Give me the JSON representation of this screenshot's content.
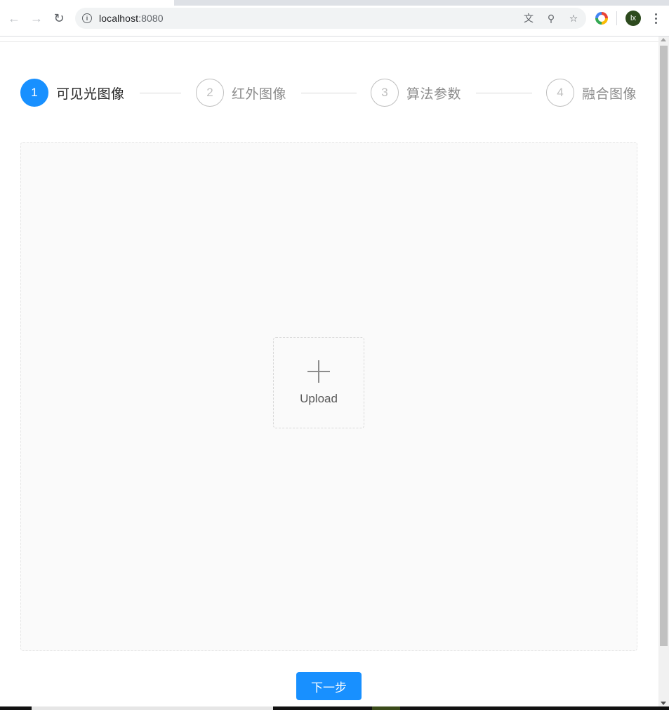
{
  "browser": {
    "url_host": "localhost",
    "url_port": ":8080",
    "avatar_initials": "lx",
    "icons": {
      "back": "arrow-left-icon",
      "forward": "arrow-right-icon",
      "reload": "reload-icon",
      "info": "info-icon",
      "translate": "translate-icon",
      "zoom": "zoom-icon",
      "bookmark": "star-icon",
      "extension": "extension-icon",
      "menu": "more-vert-icon"
    }
  },
  "steps": [
    {
      "number": "1",
      "title": "可见光图像",
      "status": "active"
    },
    {
      "number": "2",
      "title": "红外图像",
      "status": "wait"
    },
    {
      "number": "3",
      "title": "算法参数",
      "status": "wait"
    },
    {
      "number": "4",
      "title": "融合图像",
      "status": "wait"
    }
  ],
  "upload": {
    "label": "Upload",
    "icon": "plus-icon"
  },
  "actions": {
    "next_label": "下一步"
  },
  "colors": {
    "primary": "#1890ff",
    "inactive": "#bfbfbf",
    "panel_bg": "#fafafa"
  }
}
